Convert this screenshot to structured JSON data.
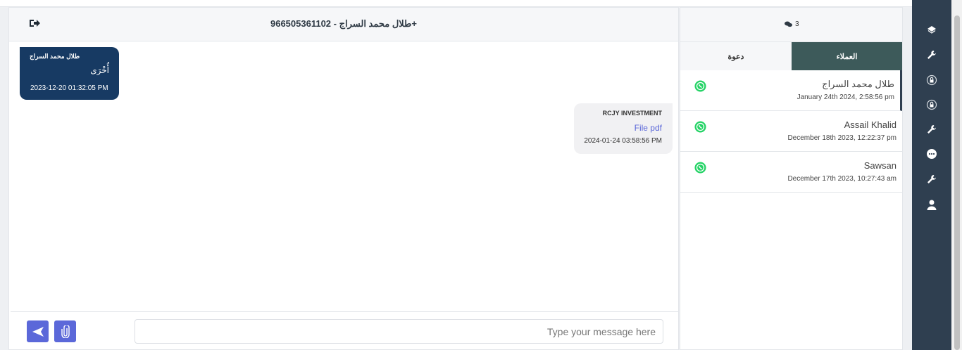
{
  "chat": {
    "title": "طلال محمد السراج - 966505361102+",
    "messages": [
      {
        "sender": "طلال محمد السراج",
        "text": "أُخْرَى",
        "time": "2023-12-20 01:32:05 PM"
      },
      {
        "sender": "RCJY INVESTMENT",
        "text": "File pdf",
        "time": "2024-01-24 03:58:56 PM"
      }
    ],
    "composer": {
      "placeholder": "Type your message here"
    }
  },
  "contacts": {
    "count": "3",
    "tabs": [
      {
        "label": "دعوة"
      },
      {
        "label": "العملاء"
      }
    ],
    "items": [
      {
        "name": "طلال محمد السراج",
        "date": "January 24th 2024, 2:58:56 pm"
      },
      {
        "name": "Assail Khalid",
        "date": "December 18th 2023, 12:22:37 pm"
      },
      {
        "name": "Sawsan",
        "date": "December 17th 2023, 10:27:43 am"
      }
    ]
  },
  "icons": {
    "nav": [
      "layers-icon",
      "wrench-icon",
      "lock-cycle-icon",
      "lock-cycle-icon",
      "wrench-icon",
      "chat-dots-icon",
      "wrench-icon",
      "user-icon"
    ],
    "whatsapp_color": "#25d366"
  },
  "colors": {
    "accent": "#5b68d9",
    "incoming_bubble": "#173a63",
    "active_tab": "#3d5a5a",
    "rail": "#2f3f50"
  }
}
